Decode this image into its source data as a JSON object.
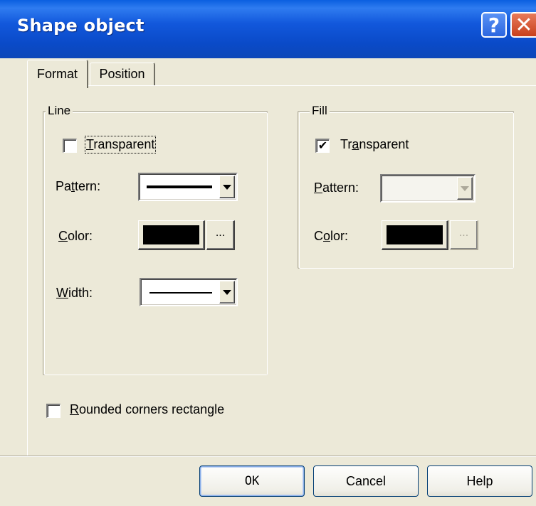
{
  "window": {
    "title": "Shape object",
    "help_glyph": "?",
    "close_glyph": "✕"
  },
  "tabs": [
    {
      "label": "Format",
      "selected": true
    },
    {
      "label": "Position",
      "selected": false
    }
  ],
  "line_group": {
    "title": "Line",
    "transparent": {
      "pre": "",
      "key": "T",
      "post": "ransparent",
      "checked": false
    },
    "pattern": {
      "pre": "Pa",
      "key": "t",
      "post": "tern:",
      "value": "solid"
    },
    "color": {
      "pre": "",
      "key": "C",
      "post": "olor:",
      "value": "#000000",
      "dots": "..."
    },
    "width": {
      "pre": "",
      "key": "W",
      "post": "idth:",
      "value": "thin"
    }
  },
  "fill_group": {
    "title": "Fill",
    "transparent": {
      "pre": "Tr",
      "key": "a",
      "post": "nsparent",
      "checked": true,
      "mark": "✔"
    },
    "pattern": {
      "pre": "",
      "key": "P",
      "post": "attern:",
      "enabled": false
    },
    "color": {
      "pre": "C",
      "key": "o",
      "post": "lor:",
      "value": "#000000",
      "dots": "...",
      "dots_enabled": false
    }
  },
  "rounded": {
    "pre": "",
    "key": "R",
    "post": "ounded corners rectangle",
    "checked": false
  },
  "buttons": {
    "ok": "OK",
    "cancel": "Cancel",
    "help": "Help"
  },
  "colors": {
    "titlebar": "#0a4ac8",
    "dialog_bg": "#ece9d8",
    "close_button": "#c8401c"
  }
}
